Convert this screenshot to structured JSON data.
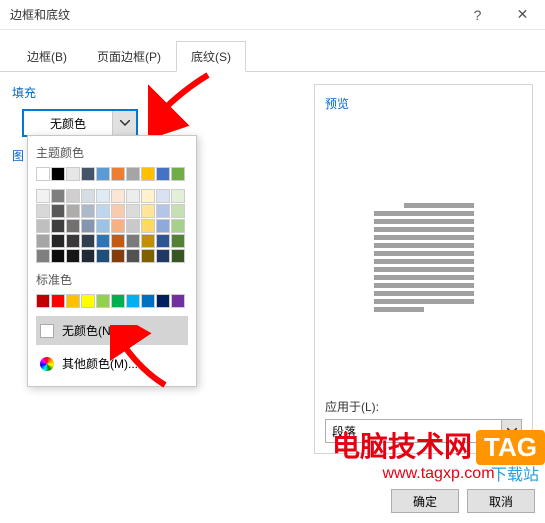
{
  "title": "边框和底纹",
  "tabs": {
    "borders": "边框(B)",
    "pageBorders": "页面边框(P)",
    "shading": "底纹(S)"
  },
  "fill": {
    "label": "填充",
    "value": "无颜色"
  },
  "pattern": {
    "label": "图"
  },
  "popup": {
    "themeTitle": "主题颜色",
    "stdTitle": "标准色",
    "noColor": "无颜色(N)",
    "moreColors": "其他颜色(M)...",
    "themeRow1": [
      "#ffffff",
      "#000000",
      "#e7e6e6",
      "#44546a",
      "#5b9bd5",
      "#ed7d31",
      "#a5a5a5",
      "#ffc000",
      "#4472c4",
      "#70ad47"
    ],
    "themeRows": [
      [
        "#f2f2f2",
        "#7f7f7f",
        "#d0cece",
        "#d6dce4",
        "#deebf6",
        "#fbe5d5",
        "#ededed",
        "#fff2cc",
        "#d9e2f3",
        "#e2efd9"
      ],
      [
        "#d8d8d8",
        "#595959",
        "#aeabab",
        "#adb9ca",
        "#bdd7ee",
        "#f7cbac",
        "#dbdbdb",
        "#fee599",
        "#b4c6e7",
        "#c5e0b3"
      ],
      [
        "#bfbfbf",
        "#3f3f3f",
        "#757070",
        "#8496b0",
        "#9cc3e5",
        "#f4b183",
        "#c9c9c9",
        "#ffd965",
        "#8eaadb",
        "#a8d08d"
      ],
      [
        "#a5a5a5",
        "#262626",
        "#3a3838",
        "#323f4f",
        "#2e75b5",
        "#c55a11",
        "#7b7b7b",
        "#bf9000",
        "#2f5496",
        "#538135"
      ],
      [
        "#7f7f7f",
        "#0c0c0c",
        "#171616",
        "#222a35",
        "#1e4e79",
        "#833c0b",
        "#525252",
        "#7f6000",
        "#1f3864",
        "#375623"
      ]
    ],
    "stdColors": [
      "#c00000",
      "#ff0000",
      "#ffc000",
      "#ffff00",
      "#92d050",
      "#00b050",
      "#00b0f0",
      "#0070c0",
      "#002060",
      "#7030a0"
    ]
  },
  "preview": {
    "label": "预览",
    "applyLabel": "应用于(L):",
    "applyValue": "段落"
  },
  "buttons": {
    "ok": "确定",
    "cancel": "取消"
  },
  "watermark": {
    "text": "电脑技术网",
    "tag": "TAG",
    "extra": "下载站",
    "url": "www.tagxp.com"
  }
}
